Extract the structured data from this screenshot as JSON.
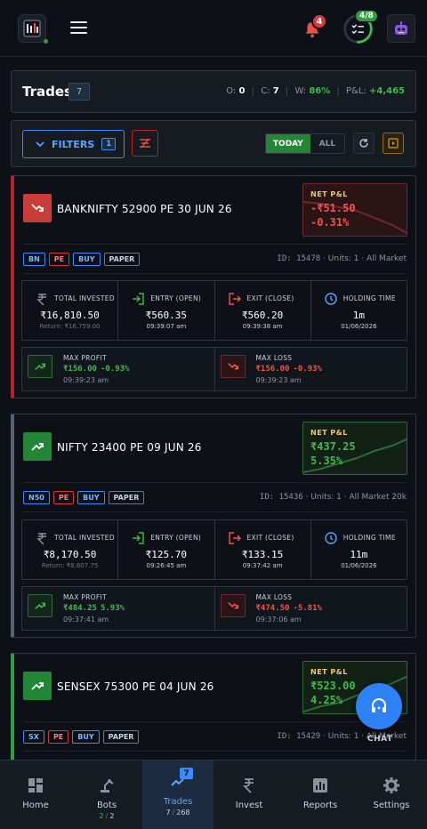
{
  "topbar": {
    "notifications_count": "4",
    "progress_label": "4/8",
    "progress_fraction": 0.5
  },
  "trades_header": {
    "title": "Trades",
    "count": "7",
    "open_label": "O:",
    "open_value": "0",
    "closed_label": "C:",
    "closed_value": "7",
    "win_label": "W:",
    "win_value": "86%",
    "pnl_label": "P&L:",
    "pnl_value": "+4,465"
  },
  "filters": {
    "label": "FILTERS",
    "count": "1",
    "today_label": "TODAY",
    "all_label": "ALL"
  },
  "trades": [
    {
      "symbol": "BANKNIFTY 52900 PE 30 JUN 26",
      "direction": "down",
      "pnl_label": "NET P&L",
      "pnl_value": "-₹51.50",
      "pnl_pct": "-0.31%",
      "tags": [
        "BN",
        "PE",
        "BUY",
        "PAPER"
      ],
      "id_text": "ID: 15478",
      "units_text": "Units: 1",
      "market_text": "All Market",
      "total_invested_label": "TOTAL INVESTED",
      "total_invested": "₹16,810.50",
      "return_text": "Return: ₹16,759.00",
      "entry_label": "ENTRY (OPEN)",
      "entry_price": "₹560.35",
      "entry_time": "09:39:07 am",
      "exit_label": "EXIT (CLOSE)",
      "exit_price": "₹560.20",
      "exit_time": "09:39:38 am",
      "holding_label": "HOLDING TIME",
      "holding_time": "1m",
      "holding_date": "01/06/2026",
      "max_profit_label": "MAX PROFIT",
      "max_profit": "₹156.00",
      "max_profit_pct": "-0.93%",
      "max_profit_time": "09:39:23 am",
      "max_loss_label": "MAX LOSS",
      "max_loss": "₹156.00",
      "max_loss_pct": "-0.93%",
      "max_loss_time": "09:39:23 am"
    },
    {
      "symbol": "NIFTY 23400 PE 09 JUN 26",
      "direction": "up",
      "pnl_label": "NET P&L",
      "pnl_value": "₹437.25",
      "pnl_pct": "5.35%",
      "tags": [
        "N50",
        "PE",
        "BUY",
        "PAPER"
      ],
      "id_text": "ID: 15436",
      "units_text": "Units: 1",
      "market_text": "All Market 20k",
      "total_invested_label": "TOTAL INVESTED",
      "total_invested": "₹8,170.50",
      "return_text": "Return: ₹8,607.75",
      "entry_label": "ENTRY (OPEN)",
      "entry_price": "₹125.70",
      "entry_time": "09:26:45 am",
      "exit_label": "EXIT (CLOSE)",
      "exit_price": "₹133.15",
      "exit_time": "09:37:42 am",
      "holding_label": "HOLDING TIME",
      "holding_time": "11m",
      "holding_date": "01/06/2026",
      "max_profit_label": "MAX PROFIT",
      "max_profit": "₹484.25",
      "max_profit_pct": "5.93%",
      "max_profit_time": "09:37:41 am",
      "max_loss_label": "MAX LOSS",
      "max_loss": "₹474.50",
      "max_loss_pct": "-5.81%",
      "max_loss_time": "09:37:06 am"
    },
    {
      "symbol": "SENSEX 75300 PE 04 JUN 26",
      "direction": "up",
      "pnl_label": "NET P&L",
      "pnl_value": "₹523.00",
      "pnl_pct": "4.25%",
      "tags": [
        "SX",
        "PE",
        "BUY",
        "PAPER"
      ],
      "id_text": "ID: 15429",
      "units_text": "Units: 1",
      "market_text": "All Market"
    }
  ],
  "chat": {
    "label": "CHAT"
  },
  "nav": [
    {
      "label": "Home",
      "icon": "dashboard-icon"
    },
    {
      "label": "Bots",
      "icon": "robot-arm-icon",
      "sub_a": "2",
      "sub_b": "2"
    },
    {
      "label": "Trades",
      "icon": "trend-icon",
      "badge": "7",
      "sub_a": "7",
      "sub_b": "268"
    },
    {
      "label": "Invest",
      "icon": "rupee-icon"
    },
    {
      "label": "Reports",
      "icon": "chart-icon"
    },
    {
      "label": "Settings",
      "icon": "gear-icon"
    }
  ],
  "colors": {
    "background": "#0d1117",
    "accent": "#2f81f7",
    "profit": "#3fb950",
    "loss": "#f85149"
  }
}
